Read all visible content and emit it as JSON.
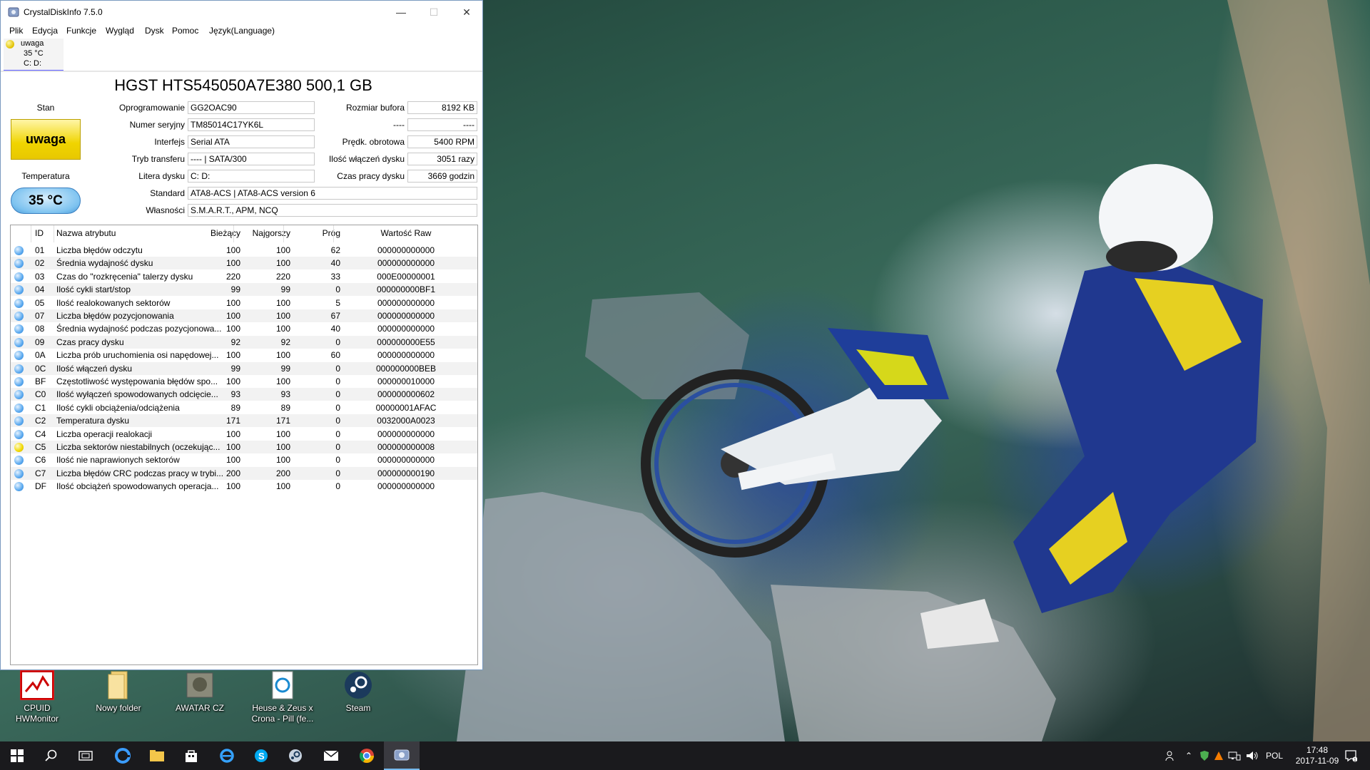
{
  "window": {
    "title": "CrystalDiskInfo 7.5.0",
    "controls": {
      "minimize": "—",
      "maximize": "☐",
      "close": "✕"
    }
  },
  "menu": [
    "Plik",
    "Edycja",
    "Funkcje",
    "Wygląd",
    "Dysk",
    "Pomoc",
    "Język(Language)"
  ],
  "disk_tab": {
    "status": "uwaga",
    "temperature": "35 °C",
    "letters": "C: D:"
  },
  "disk": {
    "model": "HGST HTS545050A7E380 500,1 GB",
    "status_label": "Stan",
    "status": "uwaga",
    "temperature_label": "Temperatura",
    "temperature": "35 °C",
    "fields_left": [
      {
        "label": "Oprogramowanie",
        "value": "GG2OAC90"
      },
      {
        "label": "Numer seryjny",
        "value": "TM85014C17YK6L"
      },
      {
        "label": "Interfejs",
        "value": "Serial ATA"
      },
      {
        "label": "Tryb transferu",
        "value": "---- | SATA/300"
      },
      {
        "label": "Litera dysku",
        "value": "C: D:"
      }
    ],
    "fields_right": [
      {
        "label": "Rozmiar bufora",
        "value": "8192 KB"
      },
      {
        "label": "----",
        "value": "----"
      },
      {
        "label": "Prędk. obrotowa",
        "value": "5400 RPM"
      },
      {
        "label": "Ilość włączeń dysku",
        "value": "3051 razy"
      },
      {
        "label": "Czas pracy dysku",
        "value": "3669 godzin"
      }
    ],
    "standard_label": "Standard",
    "standard": "ATA8-ACS | ATA8-ACS version 6",
    "features_label": "Własności",
    "features": "S.M.A.R.T., APM, NCQ"
  },
  "table": {
    "headers": {
      "id": "ID",
      "name": "Nazwa atrybutu",
      "current": "Bieżący",
      "worst": "Najgorszy",
      "threshold": "Próg",
      "raw": "Wartość Raw"
    },
    "rows": [
      {
        "status": "good",
        "id": "01",
        "name": "Liczba błędów odczytu",
        "current": "100",
        "worst": "100",
        "threshold": "62",
        "raw": "000000000000"
      },
      {
        "status": "good",
        "id": "02",
        "name": "Średnia wydajność dysku",
        "current": "100",
        "worst": "100",
        "threshold": "40",
        "raw": "000000000000"
      },
      {
        "status": "good",
        "id": "03",
        "name": "Czas do \"rozkręcenia\" talerzy dysku",
        "current": "220",
        "worst": "220",
        "threshold": "33",
        "raw": "000E00000001"
      },
      {
        "status": "good",
        "id": "04",
        "name": "Ilość cykli start/stop",
        "current": "99",
        "worst": "99",
        "threshold": "0",
        "raw": "000000000BF1"
      },
      {
        "status": "good",
        "id": "05",
        "name": "Ilość realokowanych sektorów",
        "current": "100",
        "worst": "100",
        "threshold": "5",
        "raw": "000000000000"
      },
      {
        "status": "good",
        "id": "07",
        "name": "Liczba błędów pozycjonowania",
        "current": "100",
        "worst": "100",
        "threshold": "67",
        "raw": "000000000000"
      },
      {
        "status": "good",
        "id": "08",
        "name": "Średnia wydajność podczas pozycjonowa...",
        "current": "100",
        "worst": "100",
        "threshold": "40",
        "raw": "000000000000"
      },
      {
        "status": "good",
        "id": "09",
        "name": "Czas pracy dysku",
        "current": "92",
        "worst": "92",
        "threshold": "0",
        "raw": "000000000E55"
      },
      {
        "status": "good",
        "id": "0A",
        "name": "Liczba prób uruchomienia osi napędowej...",
        "current": "100",
        "worst": "100",
        "threshold": "60",
        "raw": "000000000000"
      },
      {
        "status": "good",
        "id": "0C",
        "name": "Ilość włączeń dysku",
        "current": "99",
        "worst": "99",
        "threshold": "0",
        "raw": "000000000BEB"
      },
      {
        "status": "good",
        "id": "BF",
        "name": "Częstotliwość występowania błędów spo...",
        "current": "100",
        "worst": "100",
        "threshold": "0",
        "raw": "000000010000"
      },
      {
        "status": "good",
        "id": "C0",
        "name": "Ilość wyłączeń spowodowanych odcięcie...",
        "current": "93",
        "worst": "93",
        "threshold": "0",
        "raw": "000000000602"
      },
      {
        "status": "good",
        "id": "C1",
        "name": "Ilość cykli obciążenia/odciążenia",
        "current": "89",
        "worst": "89",
        "threshold": "0",
        "raw": "00000001AFAC"
      },
      {
        "status": "good",
        "id": "C2",
        "name": "Temperatura dysku",
        "current": "171",
        "worst": "171",
        "threshold": "0",
        "raw": "0032000A0023"
      },
      {
        "status": "good",
        "id": "C4",
        "name": "Liczba operacji realokacji",
        "current": "100",
        "worst": "100",
        "threshold": "0",
        "raw": "000000000000"
      },
      {
        "status": "caution",
        "id": "C5",
        "name": "Liczba sektorów niestabilnych (oczekując...",
        "current": "100",
        "worst": "100",
        "threshold": "0",
        "raw": "000000000008"
      },
      {
        "status": "good",
        "id": "C6",
        "name": "Ilość nie naprawionych sektorów",
        "current": "100",
        "worst": "100",
        "threshold": "0",
        "raw": "000000000000"
      },
      {
        "status": "good",
        "id": "C7",
        "name": "Liczba błędów CRC podczas pracy w trybi...",
        "current": "200",
        "worst": "200",
        "threshold": "0",
        "raw": "000000000190"
      },
      {
        "status": "good",
        "id": "DF",
        "name": "Ilość obciążeń spowodowanych operacja...",
        "current": "100",
        "worst": "100",
        "threshold": "0",
        "raw": "000000000000"
      }
    ]
  },
  "desktop_icons": [
    {
      "name": "cpuid-hwmonitor",
      "label": "CPUID HWMonitor",
      "label2": ""
    },
    {
      "name": "nowy-folder",
      "label": "Nowy folder",
      "label2": ""
    },
    {
      "name": "awatar-cz",
      "label": "AWATAR CZ",
      "label2": ""
    },
    {
      "name": "heuse-zeus",
      "label": "Heuse & Zeus x",
      "label2": "Crona - Pill (fe..."
    },
    {
      "name": "steam",
      "label": "Steam",
      "label2": ""
    }
  ],
  "taskbar": {
    "apps": [
      "start-icon",
      "search-icon",
      "task-view-icon",
      "edge-icon",
      "file-explorer-icon",
      "store-icon",
      "internet-explorer-icon",
      "skype-icon",
      "steam-icon",
      "mail-icon",
      "chrome-icon",
      "crystaldiskinfo-icon"
    ],
    "language": "POL",
    "time": "17:48",
    "date": "2017-11-09"
  },
  "colors": {
    "caution": "#f0d400",
    "good": "#5aa9ef",
    "accent": "#5a5aff"
  }
}
